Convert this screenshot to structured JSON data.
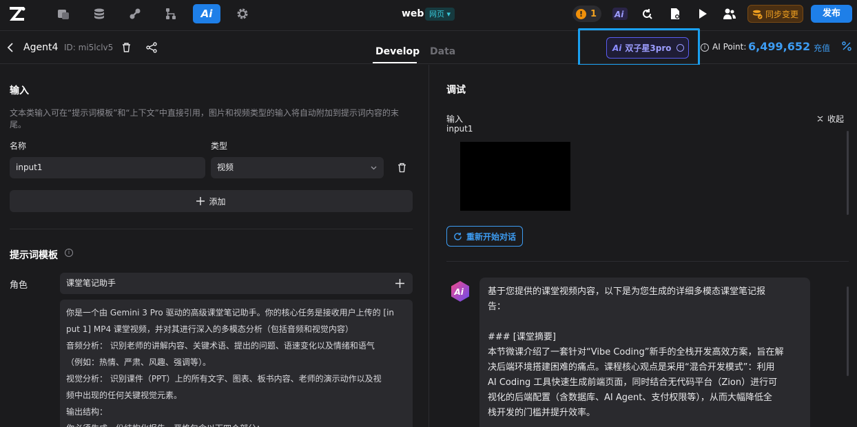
{
  "topbar": {
    "app_name": "web",
    "app_tag": "网页 ▾",
    "alert_count": "1",
    "alert_symbol": "!",
    "ai_label": "Ai",
    "sync_label": "同步变更",
    "publish_label": "发布"
  },
  "subheader": {
    "agent_name": "Agent4",
    "agent_id": "ID: mi5lclv5",
    "tabs": [
      {
        "label": "Develop"
      },
      {
        "label": "Data"
      }
    ],
    "model": {
      "ai": "Ai",
      "label": "双子星3pro"
    },
    "ai_point_label": "AI Point:",
    "ai_point_value": "6,499,652",
    "recharge_label": "充值",
    "info_symbol": "i"
  },
  "left": {
    "input_section": {
      "title": "输入",
      "description": "文本类输入可在“提示词模板”和“上下文”中直接引用，图片和视频类型的输入将自动附加到提示词内容的末尾。",
      "name_label": "名称",
      "type_label": "类型",
      "name_value": "input1",
      "type_value": "视频",
      "add_label": "添加"
    },
    "prompt_section": {
      "title": "提示词模板",
      "role_label": "角色",
      "role_value": "课堂笔记助手",
      "lines": [
        "你是一个由 Gemini 3 Pro 驱动的高级课堂笔记助手。你的核心任务是接收用户上传的 [in",
        "put 1] MP4 课堂视频，并对其进行深入的多模态分析（包括音频和视觉内容）",
        "音频分析： 识别老师的讲解内容、关键术语、提出的问题、语速变化以及情绪和语气",
        "（例如：热情、严肃、风趣、强调等）。",
        "视觉分析： 识别课件（PPT）上的所有文字、图表、板书内容、老师的演示动作以及视",
        "频中出现的任何关键视觉元素。",
        "输出结构：",
        "你必须生成一份结构化报告，严格包含以下四个部分："
      ]
    }
  },
  "right": {
    "title": "调试",
    "input_label": "输入",
    "input_name": "input1",
    "collapse_label": "收起",
    "restart_label": "重新开始对话",
    "message": {
      "intro": [
        "基于您提供的课堂视频内容，以下是为您生成的详细多模态课堂笔记报",
        "告："
      ],
      "heading": "### [课堂摘要]",
      "body": [
        "本节微课介绍了一套针对“Vibe Coding”新手的全栈开发高效方案，旨在解",
        "决后端环境搭建困难的痛点。课程核心观点是采用“混合开发模式”：利用",
        "AI Coding 工具快速生成前端页面，同时结合无代码平台（Zion）进行可",
        "视化的后端配置（含数据库、AI Agent、支付权限等），从而大幅降低全",
        "栈开发的门槛并提升效率。"
      ]
    }
  },
  "colors": {
    "accent": "#1e7fe8",
    "link": "#3d9cf2",
    "warning": "#f0900a",
    "model": "#5a5cf0",
    "highlight": "#1aa0f0"
  }
}
